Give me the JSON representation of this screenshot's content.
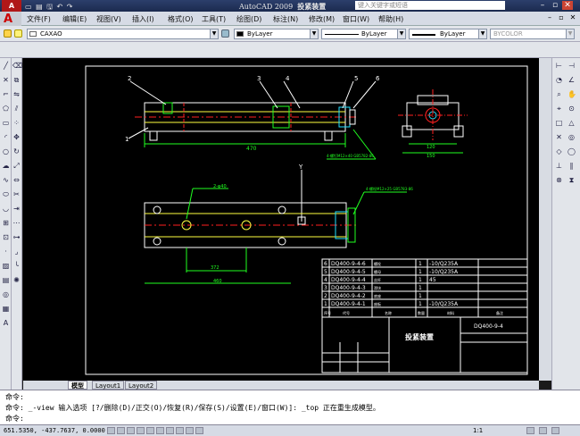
{
  "titlebar": {
    "app": "AutoCAD 2009",
    "doc": "投紧装置",
    "search_placeholder": "键入关键字或短语"
  },
  "menu": [
    "文件(F)",
    "编辑(E)",
    "视图(V)",
    "插入(I)",
    "格式(O)",
    "工具(T)",
    "绘图(D)",
    "标注(N)",
    "修改(M)",
    "窗口(W)",
    "帮助(H)"
  ],
  "layer": {
    "name": "CAXAO"
  },
  "props": {
    "color": "ByLayer",
    "linetype": "ByLayer",
    "lineweight": "ByLayer",
    "plotstyle": "BYCOLOR"
  },
  "tabs": {
    "model": "模型",
    "layout1": "Layout1",
    "layout2": "Layout2"
  },
  "command": {
    "line1": "命令:",
    "line2": "命令: _-view 输入选项 [?/删除(D)/正交(O)/恢复(R)/保存(S)/设置(E)/窗口(W)]: _top 正在重生成模型。",
    "line3": "命令:"
  },
  "status": {
    "coords": "651.5350, -437.7637, 0.0000",
    "scale": "1:1"
  },
  "drawing": {
    "balloons": [
      "2",
      "3",
      "4",
      "5",
      "6",
      "1"
    ],
    "dims": {
      "top_len": "470",
      "end_w1": "120",
      "end_w2": "150",
      "slot": "2-φ40",
      "len2": "372",
      "len3": "460"
    },
    "notes": {
      "n1": "4-螺钉M12×40 GB5782-86",
      "n2": "4-螺栓M12×25 GB5783-86"
    },
    "axis_y": "Y",
    "bom": [
      {
        "no": "6",
        "code": "DQ400-9-4-6",
        "name": "螺栓",
        "qty": "1",
        "mat": "-10/Q235A"
      },
      {
        "no": "5",
        "code": "DQ400-9-4-5",
        "name": "螺母",
        "qty": "1",
        "mat": "-10/Q235A"
      },
      {
        "no": "4",
        "code": "DQ400-9-4-4",
        "name": "丝杆",
        "qty": "1",
        "mat": "45"
      },
      {
        "no": "3",
        "code": "DQ400-9-4-3",
        "name": "滑块",
        "qty": "1",
        "mat": ""
      },
      {
        "no": "2",
        "code": "DQ400-9-4-2",
        "name": "底座",
        "qty": "1",
        "mat": ""
      },
      {
        "no": "1",
        "code": "DQ400-9-4-1",
        "name": "座板",
        "qty": "1",
        "mat": "-10/Q235A"
      }
    ],
    "bom_header": {
      "no": "序号",
      "code": "代号",
      "name": "名称",
      "qty": "数量",
      "mat": "材料",
      "note": "备注"
    },
    "title_block": {
      "name": "投紧装置",
      "code": "DQ400-9-4"
    }
  },
  "colors": {
    "accent_red": "#ff2020",
    "line_green": "#20ff20",
    "line_white": "#ffffff",
    "line_cyan": "#20e0ff",
    "line_yellow": "#ffff40"
  }
}
